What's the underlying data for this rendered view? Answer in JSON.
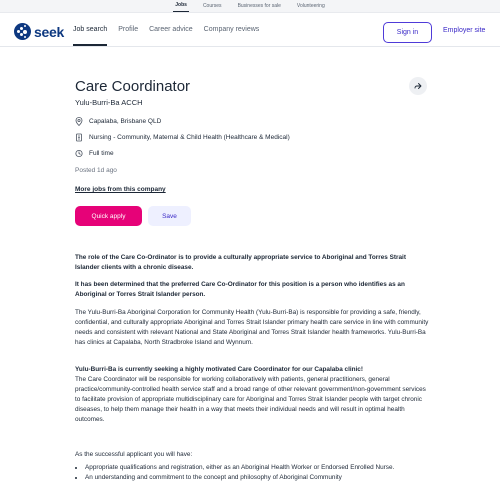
{
  "topbar": {
    "items": [
      "Jobs",
      "Courses",
      "Businesses for sale",
      "Volunteering"
    ]
  },
  "nav": {
    "logo_text": "seek",
    "links": [
      "Job search",
      "Profile",
      "Career advice",
      "Company reviews"
    ],
    "sign_in": "Sign in",
    "employer_site": "Employer site"
  },
  "job": {
    "title": "Care Coordinator",
    "advertiser": "Yulu-Burri-Ba ACCH",
    "location": "Capalaba, Brisbane QLD",
    "classification": "Nursing - Community, Maternal & Child Health (Healthcare & Medical)",
    "work_type": "Full time",
    "posted": "Posted 1d ago",
    "more_jobs": "More jobs from this company",
    "quick_apply": "Quick apply",
    "save": "Save"
  },
  "description": {
    "p1": "The role of the Care Co-Ordinator is to provide a culturally appropriate service to Aboriginal and Torres Strait Islander clients with a chronic disease.",
    "p2": "It has been determined that the preferred Care Co-Ordinator for this position is a person who identifies as an Aboriginal or Torres Strait Islander person.",
    "p3": "The Yulu-Burri-Ba Aboriginal Corporation for Community Health (Yulu-Burri-Ba) is responsible for providing a safe, friendly, confidential, and culturally appropriate Aboriginal and Torres Strait Islander primary health care service in line with community needs and consistent with relevant National and State Aboriginal and Torres Strait Islander health frameworks. Yulu-Burri-Ba has clinics at Capalaba, North Stradbroke Island and Wynnum.",
    "p4_heading": "Yulu-Burri-Ba is currently seeking a highly motivated Care Coordinator for our Capalaba clinic!",
    "p4": "The Care Coordinator will be responsible for working collaboratively with patients, general practitioners, general practice/community-controlled health service staff and a broad range of other relevant government/non-government services to facilitate provision of appropriate multidisciplinary care for Aboriginal and Torres Strait Islander people with target chronic diseases, to help them manage their health in a way that meets their individual needs and will result in optimal health outcomes.",
    "p5": "As the successful applicant you will have:",
    "bullets": [
      " Appropriate qualifications and registration, either as an Aboriginal Health Worker or Endorsed Enrolled Nurse.",
      "An understanding and commitment to the concept and philosophy of Aboriginal Community"
    ]
  }
}
